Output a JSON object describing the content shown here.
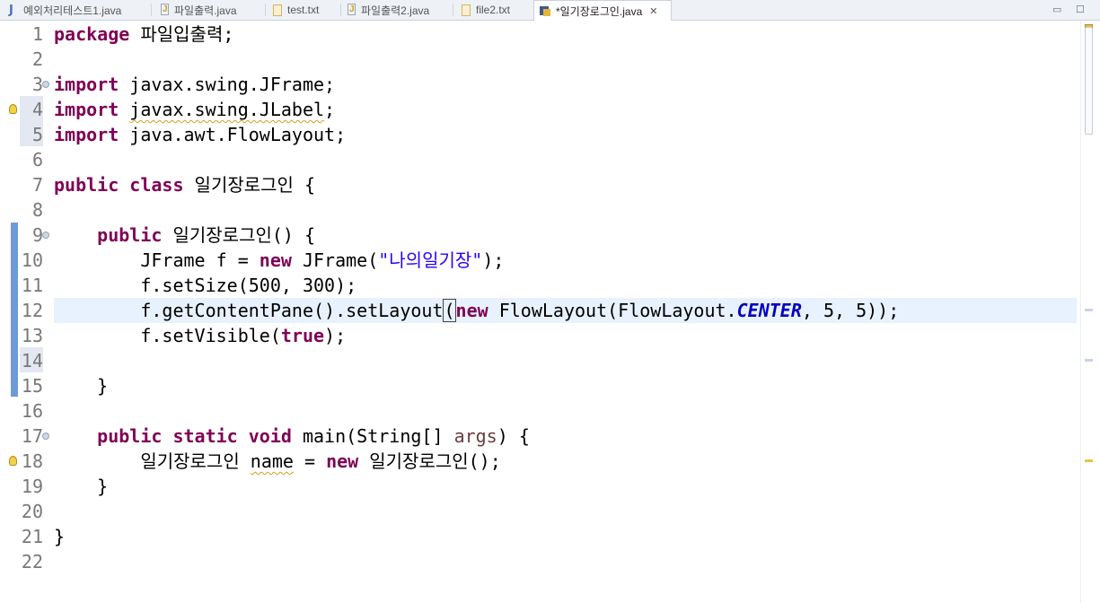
{
  "tabs": [
    {
      "label": "예외처리테스트1.java",
      "icon": "java-file-icon",
      "active": false
    },
    {
      "label": "파일출력.java",
      "icon": "java-source-icon",
      "active": false
    },
    {
      "label": "test.txt",
      "icon": "text-file-icon",
      "active": false
    },
    {
      "label": "파일출력2.java",
      "icon": "java-source-icon",
      "active": false
    },
    {
      "label": "file2.txt",
      "icon": "text-file-icon",
      "active": false
    },
    {
      "label": "*일기장로그인.java",
      "icon": "java-run-icon",
      "active": true,
      "close": "✕"
    }
  ],
  "window_controls": {
    "minimize": "▭",
    "maximize": "☐"
  },
  "editor": {
    "line_numbers": [
      "1",
      "2",
      "3",
      "4",
      "5",
      "6",
      "7",
      "8",
      "9",
      "10",
      "11",
      "12",
      "13",
      "14",
      "15",
      "16",
      "17",
      "18",
      "19",
      "20",
      "21",
      "22"
    ],
    "lines": {
      "l1": {
        "kw": "package",
        "rest": " 파일입출력;"
      },
      "l3": {
        "kw": "import",
        "rest": " javax.swing.JFrame;"
      },
      "l4": {
        "kw": "import",
        "sp": " ",
        "warn": "javax.swing.JLabel",
        "rest": ";"
      },
      "l5": {
        "kw": "import",
        "rest": " java.awt.FlowLayout;"
      },
      "l7": {
        "kw1": "public",
        "sp": " ",
        "kw2": "class",
        "rest": " 일기장로그인 {"
      },
      "l9": {
        "ind": "    ",
        "kw": "public",
        "rest": " 일기장로그인() {"
      },
      "l10": {
        "a": "        JFrame f = ",
        "kw": "new",
        "b": " JFrame(",
        "str": "\"나의일기장\"",
        "c": ");"
      },
      "l11": {
        "a": "        f.setSize(500, 300);"
      },
      "l12": {
        "a": "        f.getContentPane().setLayout",
        "br": "(",
        "kw": "new",
        "b": " FlowLayout(FlowLayout.",
        "fld": "CENTER",
        "c": ", 5, 5));"
      },
      "l13": {
        "a": "        f.setVisible(",
        "kw": "true",
        "b": ");"
      },
      "l15": {
        "a": "    }"
      },
      "l17": {
        "ind": "    ",
        "kw1": "public",
        "kw2": "static",
        "kw3": "void",
        "a": " main(String[] ",
        "par": "args",
        "b": ") {"
      },
      "l18": {
        "a": "        일기장로그인 ",
        "warn": "name",
        "b": " = ",
        "kw": "new",
        "c": " 일기장로그인();"
      },
      "l19": {
        "a": "    }"
      },
      "l21": {
        "a": "}"
      }
    }
  },
  "colors": {
    "keyword": "#7f0055",
    "string": "#2a00ff",
    "static_field": "#0000c0",
    "parameter": "#6a3e3e",
    "current_line": "#e8f2fe",
    "quick_diff": "#6c9bd6",
    "warning": "#e8c448"
  }
}
